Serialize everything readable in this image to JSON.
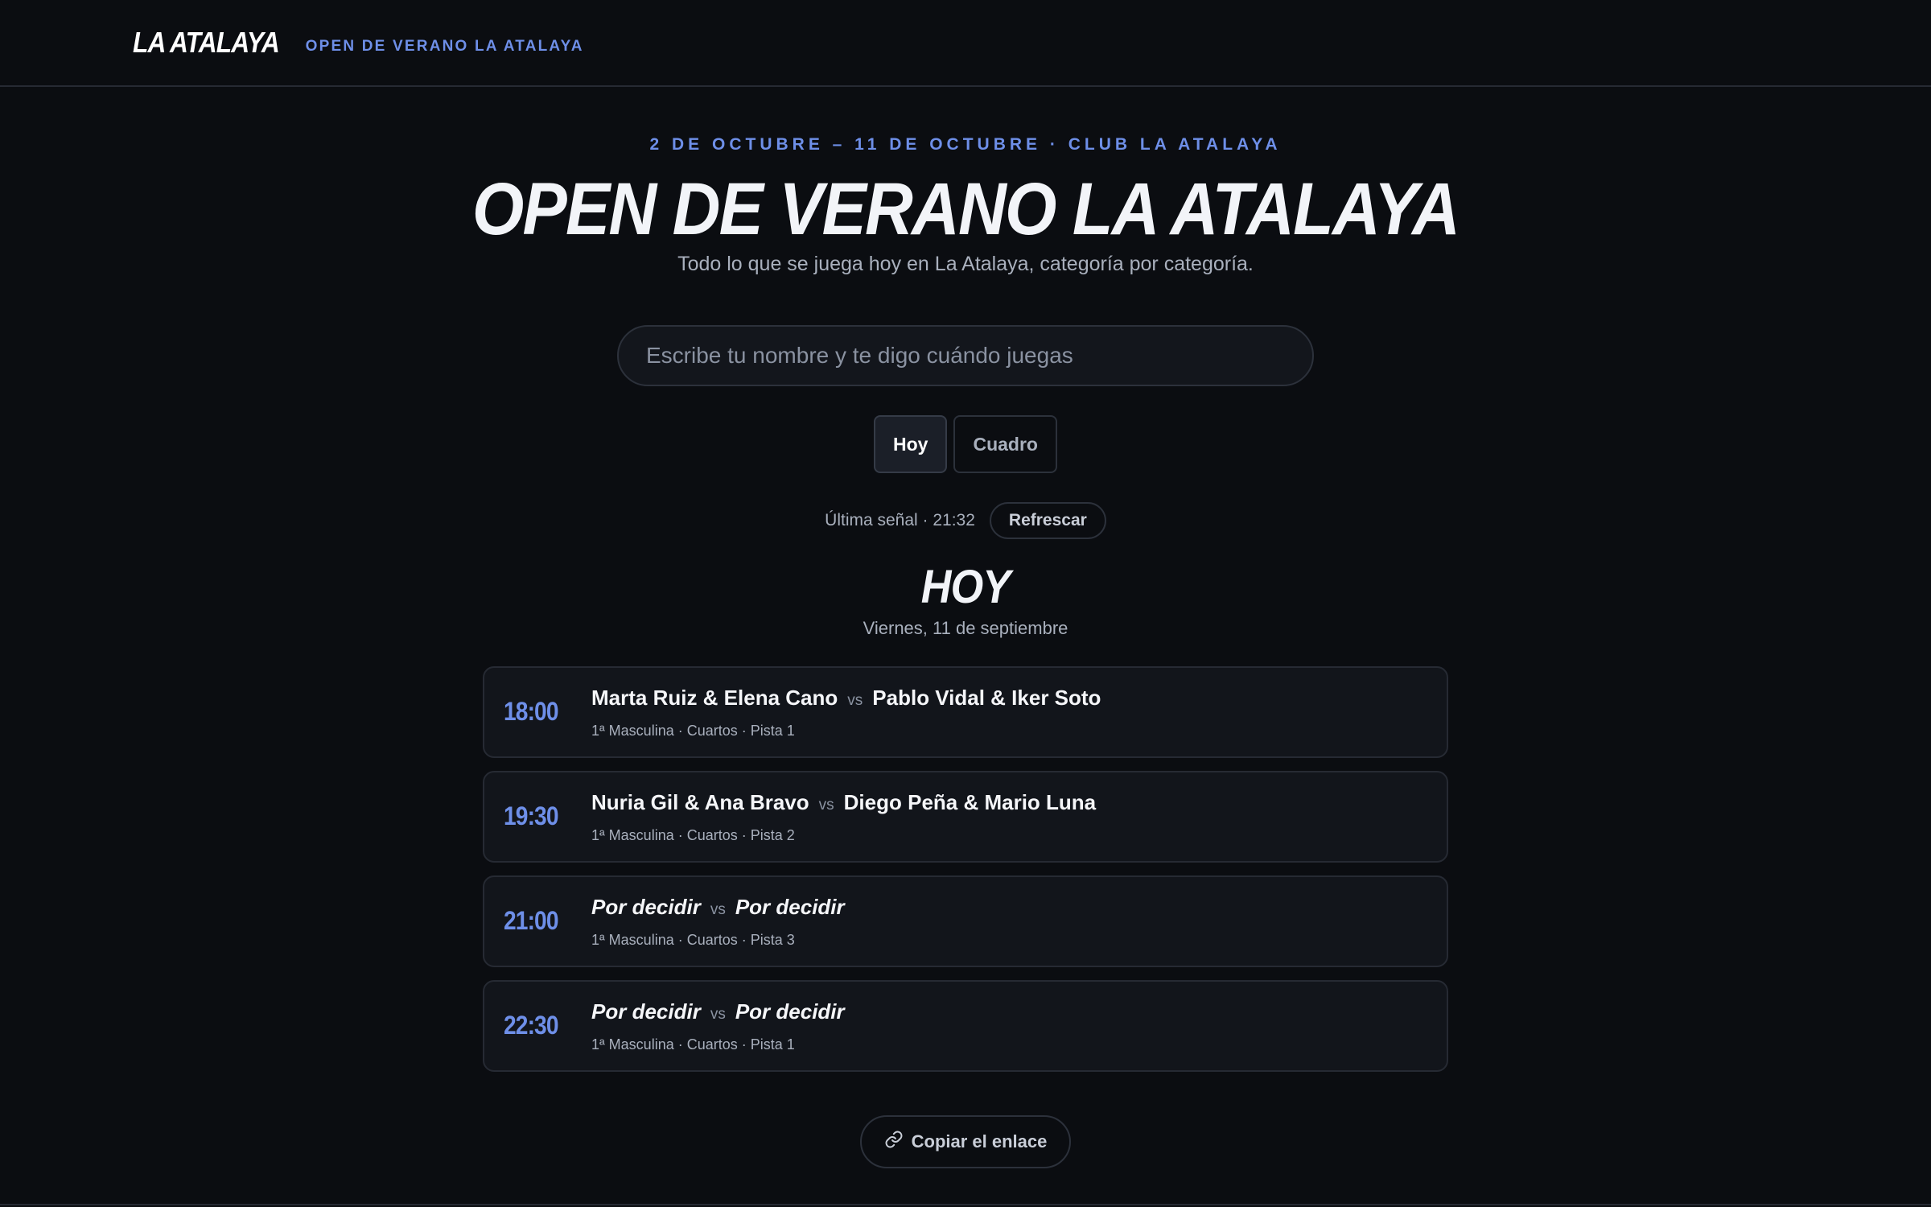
{
  "header": {
    "brand": "LA ATALAYA",
    "subtitle": "OPEN DE VERANO LA ATALAYA"
  },
  "hero": {
    "kicker": "2 DE OCTUBRE – 11 DE OCTUBRE · CLUB LA ATALAYA",
    "title": "OPEN DE VERANO LA ATALAYA",
    "subtitle": "Todo lo que se juega hoy en La Atalaya, categoría por categoría."
  },
  "search": {
    "placeholder": "Escribe tu nombre y te digo cuándo juegas",
    "value": ""
  },
  "tabs": [
    {
      "label": "Hoy",
      "active": true
    },
    {
      "label": "Cuadro",
      "active": false
    }
  ],
  "status": {
    "last_signal": "Última señal · 21:32",
    "refresh_label": "Refrescar"
  },
  "day": {
    "title": "HOY",
    "date": "Viernes, 11 de septiembre"
  },
  "matches": [
    {
      "time": "18:00",
      "team1": "Marta Ruiz & Elena Cano",
      "vs": "vs",
      "team2": "Pablo Vidal & Iker Soto",
      "meta": "1ª Masculina · Cuartos · Pista 1"
    },
    {
      "time": "19:30",
      "team1": "Nuria Gil & Ana Bravo",
      "vs": "vs",
      "team2": "Diego Peña & Mario Luna",
      "meta": "1ª Masculina · Cuartos · Pista 2"
    },
    {
      "time": "21:00",
      "team1": "Por decidir",
      "vs": "vs",
      "team2": "Por decidir",
      "meta": "1ª Masculina · Cuartos · Pista 3"
    },
    {
      "time": "22:30",
      "team1": "Por decidir",
      "vs": "vs",
      "team2": "Por decidir",
      "meta": "1ª Masculina · Cuartos · Pista 1"
    }
  ],
  "footer": {
    "copy_label": "Copiar el enlace",
    "copy_icon": "link-icon"
  },
  "colors": {
    "background": "#0b0d11",
    "accent": "#6e8fe8",
    "card": "#12151b",
    "border": "#262a33"
  }
}
